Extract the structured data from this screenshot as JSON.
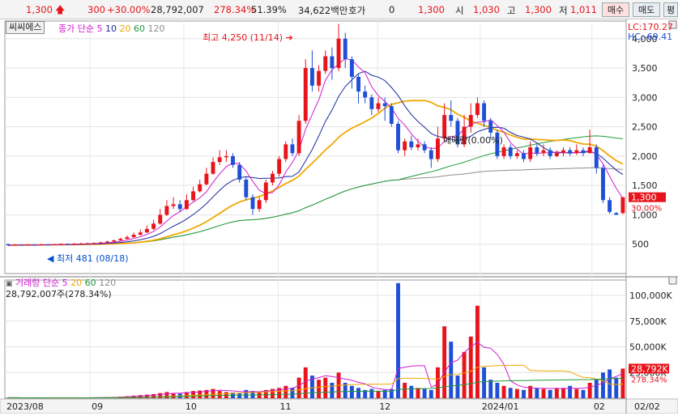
{
  "quote": {
    "price": "1,300",
    "up_arrow": "up-arrow",
    "change": "300",
    "change_pct": "+30.00%",
    "volume": "28,792,007",
    "volume_ratio": "278.34%",
    "turnover_pct": "51.39%",
    "amount": "34,622백만",
    "bid_label": "호가",
    "bid_value": "0",
    "ask_value": "1,300",
    "open_label": "시",
    "open_value": "1,030",
    "high_label": "고",
    "high_value": "1,300",
    "low_label": "저",
    "low_value": "1,011",
    "buy_label": "매수",
    "sell_label": "매도",
    "extra_label": "평"
  },
  "symbol": "씨씨에스",
  "price_legend": {
    "label": "종가",
    "ma": "단순",
    "periods": [
      "5",
      "10",
      "20",
      "60",
      "120"
    ]
  },
  "volume_legend": {
    "label": "거래량",
    "ma": "단순",
    "periods": [
      "5",
      "20",
      "60",
      "120"
    ],
    "value": "28,792,007주(278.34%)"
  },
  "lc": "LC:170.27",
  "hc": "HC:-69.41",
  "annot_high": "최고 4,250 (11/14)",
  "annot_low": "최저 481 (08/18)",
  "annot_mid": "매매량(0.00%)",
  "price_tag": "1,300",
  "pct_tag": "30.00%",
  "vol_tag": "28,792K",
  "vol_pct_tag": "278.34%",
  "price_ticks": [
    "4,000",
    "3,500",
    "3,000",
    "2,500",
    "2,000",
    "1,500",
    "1,000",
    "500"
  ],
  "volume_ticks": [
    "100,000K",
    "75,000K",
    "50,000K",
    "25,000K"
  ],
  "date_ticks": [
    "2023/08",
    "09",
    "10",
    "11",
    "12",
    "2024/01",
    "02"
  ],
  "corner_date": "02/02",
  "colors": {
    "up": "#e8141b",
    "down": "#1f4fd6",
    "ma5": "#d01bd0",
    "ma10": "#1a2a9c",
    "ma20": "#f0a800",
    "ma60": "#1f9a3a",
    "ma120": "#8c8c8c"
  },
  "chart_data": {
    "type": "candlestick",
    "price_range": [
      0,
      4300
    ],
    "candles": [
      [
        500,
        480,
        510,
        478
      ],
      [
        480,
        490,
        500,
        475
      ],
      [
        490,
        485,
        495,
        481
      ],
      [
        485,
        492,
        500,
        482
      ],
      [
        492,
        488,
        498,
        480
      ],
      [
        488,
        495,
        505,
        485
      ],
      [
        495,
        490,
        500,
        485
      ],
      [
        490,
        498,
        505,
        486
      ],
      [
        498,
        505,
        515,
        494
      ],
      [
        505,
        500,
        512,
        495
      ],
      [
        500,
        508,
        520,
        498
      ],
      [
        508,
        510,
        525,
        502
      ],
      [
        510,
        515,
        525,
        505
      ],
      [
        515,
        520,
        530,
        510
      ],
      [
        520,
        530,
        545,
        515
      ],
      [
        530,
        545,
        560,
        525
      ],
      [
        545,
        565,
        580,
        540
      ],
      [
        565,
        590,
        610,
        560
      ],
      [
        590,
        620,
        650,
        585
      ],
      [
        620,
        660,
        700,
        610
      ],
      [
        660,
        700,
        750,
        650
      ],
      [
        700,
        760,
        820,
        690
      ],
      [
        760,
        850,
        920,
        740
      ],
      [
        850,
        1000,
        1100,
        830
      ],
      [
        1000,
        1150,
        1250,
        980
      ],
      [
        1150,
        1180,
        1300,
        1100
      ],
      [
        1180,
        1100,
        1250,
        1050
      ],
      [
        1100,
        1250,
        1350,
        1080
      ],
      [
        1250,
        1400,
        1480,
        1230
      ],
      [
        1400,
        1520,
        1600,
        1380
      ],
      [
        1520,
        1700,
        1800,
        1500
      ],
      [
        1700,
        1900,
        1980,
        1680
      ],
      [
        1900,
        1980,
        2100,
        1850
      ],
      [
        1980,
        2000,
        2100,
        1900
      ],
      [
        2000,
        1850,
        2050,
        1800
      ],
      [
        1850,
        1600,
        1900,
        1550
      ],
      [
        1600,
        1300,
        1650,
        1250
      ],
      [
        1300,
        1100,
        1350,
        1000
      ],
      [
        1100,
        1250,
        1300,
        1050
      ],
      [
        1250,
        1550,
        1600,
        1200
      ],
      [
        1550,
        1700,
        1750,
        1500
      ],
      [
        1700,
        1950,
        2000,
        1650
      ],
      [
        1950,
        2200,
        2250,
        1900
      ],
      [
        2200,
        2050,
        2300,
        2000
      ],
      [
        2050,
        2600,
        2700,
        2000
      ],
      [
        2600,
        3500,
        3650,
        2550
      ],
      [
        3500,
        3200,
        3800,
        3100
      ],
      [
        3200,
        3450,
        3550,
        3100
      ],
      [
        3450,
        3700,
        3800,
        3400
      ],
      [
        3700,
        3500,
        3850,
        3300
      ],
      [
        3500,
        4000,
        4250,
        3450
      ],
      [
        4000,
        3650,
        4100,
        3500
      ],
      [
        3650,
        3350,
        3700,
        3150
      ],
      [
        3350,
        3100,
        3400,
        2900
      ],
      [
        3100,
        3000,
        3200,
        2900
      ],
      [
        3000,
        2800,
        3050,
        2700
      ],
      [
        2800,
        2900,
        3000,
        2750
      ],
      [
        2900,
        2850,
        3000,
        2600
      ],
      [
        2850,
        2550,
        2900,
        2500
      ],
      [
        2550,
        2100,
        2600,
        2050
      ],
      [
        2100,
        2250,
        2300,
        2000
      ],
      [
        2250,
        2150,
        2350,
        2100
      ],
      [
        2150,
        2200,
        2300,
        2100
      ],
      [
        2200,
        2100,
        2250,
        2050
      ],
      [
        2100,
        1950,
        2150,
        1800
      ],
      [
        1950,
        2300,
        2500,
        1900
      ],
      [
        2300,
        2700,
        2900,
        2250
      ],
      [
        2700,
        2600,
        2950,
        2500
      ],
      [
        2600,
        2200,
        2650,
        2150
      ],
      [
        2200,
        2500,
        2700,
        2150
      ],
      [
        2500,
        2700,
        2900,
        2400
      ],
      [
        2700,
        2900,
        3000,
        2650
      ],
      [
        2900,
        2600,
        2950,
        2500
      ],
      [
        2600,
        2400,
        2650,
        2300
      ],
      [
        2400,
        2000,
        2450,
        1950
      ],
      [
        2000,
        2150,
        2200,
        1950
      ],
      [
        2150,
        2000,
        2200,
        1950
      ],
      [
        2000,
        2050,
        2100,
        1950
      ],
      [
        2050,
        1950,
        2100,
        1900
      ],
      [
        1950,
        2150,
        2250,
        1900
      ],
      [
        2150,
        2050,
        2200,
        2000
      ],
      [
        2050,
        2100,
        2200,
        2000
      ],
      [
        2100,
        2000,
        2150,
        1950
      ],
      [
        2000,
        2050,
        2100,
        1980
      ],
      [
        2050,
        2100,
        2150,
        2000
      ],
      [
        2100,
        2050,
        2150,
        2000
      ],
      [
        2050,
        2100,
        2200,
        2020
      ],
      [
        2100,
        2050,
        2150,
        2000
      ],
      [
        2050,
        2150,
        2450,
        2050
      ],
      [
        2150,
        1800,
        2200,
        1700
      ],
      [
        1800,
        1250,
        1850,
        1200
      ],
      [
        1250,
        1050,
        1300,
        1020
      ],
      [
        1030,
        1000,
        1050,
        1011
      ],
      [
        1030,
        1300,
        1300,
        1011
      ]
    ],
    "volume_range": [
      0,
      115000
    ],
    "volumes": [
      500,
      400,
      300,
      350,
      300,
      300,
      250,
      280,
      300,
      320,
      350,
      400,
      500,
      600,
      800,
      1000,
      1200,
      1500,
      2000,
      2500,
      3000,
      3500,
      4000,
      5000,
      6000,
      5000,
      4500,
      6000,
      7000,
      7500,
      8000,
      9000,
      7000,
      6000,
      5500,
      5000,
      8000,
      7000,
      6000,
      8000,
      9000,
      10000,
      12000,
      10000,
      20000,
      30000,
      22000,
      18000,
      20000,
      15000,
      25000,
      15000,
      12000,
      10000,
      8000,
      9000,
      7000,
      8000,
      9000,
      112000,
      15000,
      12000,
      10000,
      9000,
      8000,
      30000,
      70000,
      55000,
      22000,
      45000,
      60000,
      90000,
      30000,
      18000,
      15000,
      12000,
      10000,
      9000,
      8000,
      12000,
      10000,
      9000,
      8000,
      9500,
      10000,
      12000,
      9000,
      8000,
      15000,
      18000,
      25000,
      28000,
      20000,
      28792
    ]
  }
}
